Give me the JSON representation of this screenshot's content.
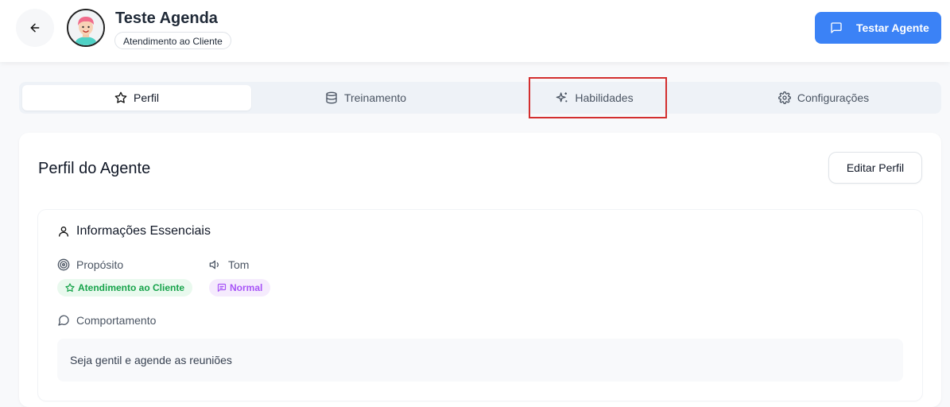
{
  "header": {
    "agent_name": "Teste Agenda",
    "agent_category": "Atendimento ao Cliente",
    "test_button_label": "Testar Agente"
  },
  "tabs": [
    {
      "label": "Perfil",
      "icon": "star-icon",
      "active": true
    },
    {
      "label": "Treinamento",
      "icon": "database-icon",
      "active": false
    },
    {
      "label": "Habilidades",
      "icon": "sparkles-icon",
      "active": false
    },
    {
      "label": "Configurações",
      "icon": "gear-icon",
      "active": false
    }
  ],
  "profile": {
    "title": "Perfil do Agente",
    "edit_button_label": "Editar Perfil",
    "essentials": {
      "title": "Informações Essenciais",
      "purpose_label": "Propósito",
      "purpose_value": "Atendimento ao Cliente",
      "tone_label": "Tom",
      "tone_value": "Normal",
      "behavior_label": "Comportamento",
      "behavior_value": "Seja gentil e agende as reuniões"
    }
  },
  "colors": {
    "primary": "#3b82f6",
    "highlight": "#d32f2f",
    "purpose_pill_bg": "#e9f9ee",
    "purpose_pill_text": "#16a34a",
    "tone_pill_bg": "#f5ebfd",
    "tone_pill_text": "#a855f7"
  }
}
